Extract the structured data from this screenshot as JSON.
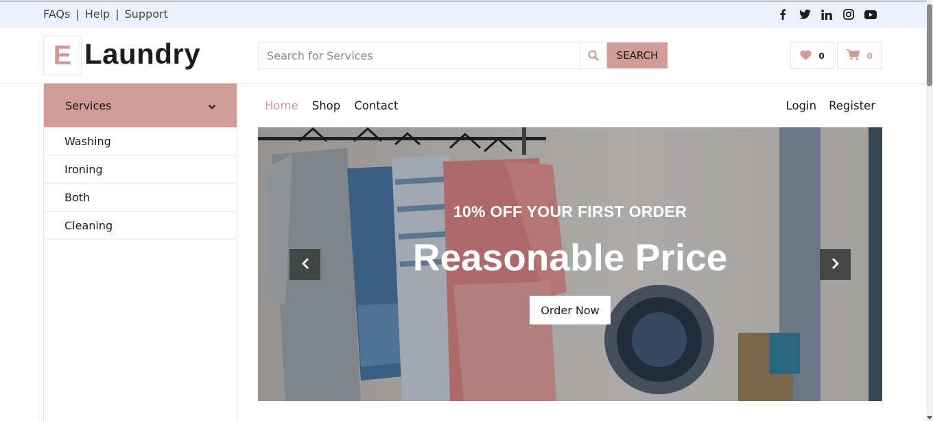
{
  "topbar": {
    "links": [
      "FAQs",
      "Help",
      "Support"
    ],
    "separator": "|",
    "social_icons": [
      "facebook-icon",
      "twitter-icon",
      "linkedin-icon",
      "instagram-icon",
      "youtube-icon"
    ]
  },
  "header": {
    "logo_letter": "E",
    "logo_text": "Laundry",
    "search": {
      "placeholder": "Search for Services",
      "value": "",
      "button_label": "SEARCH"
    },
    "wishlist_count": "0",
    "cart_count": "0"
  },
  "sidebar": {
    "title": "Services",
    "items": [
      "Washing",
      "Ironing",
      "Both",
      "Cleaning"
    ]
  },
  "nav": {
    "links": [
      "Home",
      "Shop",
      "Contact"
    ],
    "active": "Home",
    "auth": [
      "Login",
      "Register"
    ]
  },
  "carousel": {
    "promo": "10% OFF YOUR FIRST ORDER",
    "headline": "Reasonable Price",
    "button": "Order Now"
  },
  "colors": {
    "accent": "#d19c97",
    "topbar_bg": "#edf1ff",
    "text": "#1c1c1c"
  }
}
